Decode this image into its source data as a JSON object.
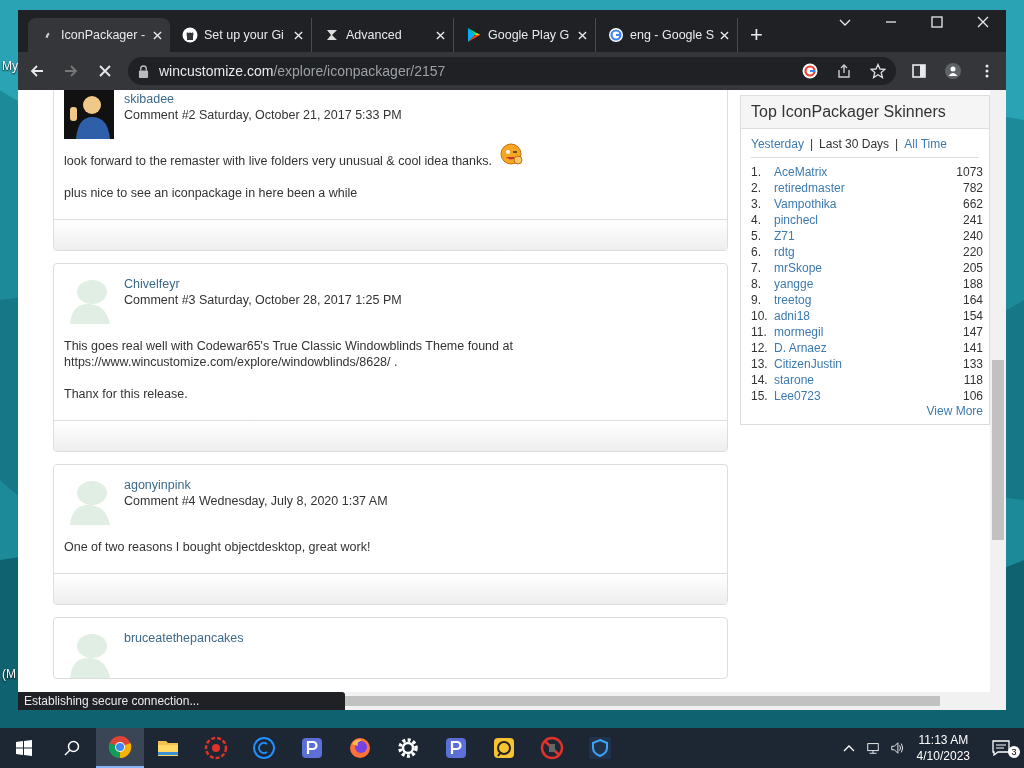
{
  "desktop": {
    "labels": [
      "My",
      "(M"
    ]
  },
  "browser": {
    "tabs": [
      {
        "title": "IconPackager -",
        "selected": true,
        "kind": "spinner"
      },
      {
        "title": "Set up your Gi",
        "selected": false,
        "kind": "github"
      },
      {
        "title": "Advanced",
        "selected": false,
        "kind": "s3"
      },
      {
        "title": "Google Play G",
        "selected": false,
        "kind": "play"
      },
      {
        "title": "eng - Google S",
        "selected": false,
        "kind": "google"
      }
    ],
    "new_tab": "+",
    "url_host": "wincustomize.com",
    "url_path": "/explore/iconpackager/2157",
    "status": "Establishing secure connection..."
  },
  "comments": [
    {
      "user": "skibadee",
      "meta": "Comment #2 Saturday, October 21, 2017 5:33 PM",
      "kind": "figure",
      "paragraphs": [
        {
          "text": "look forward to the remaster with live folders very unusual & cool idea thanks.",
          "emoji": true
        },
        {
          "text": "plus nice to see an iconpackage in here been a while",
          "emoji": false
        }
      ]
    },
    {
      "user": "Chivelfeyr",
      "meta": "Comment #3 Saturday, October 28, 2017 1:25 PM",
      "kind": "default",
      "paragraphs": [
        {
          "text": "This goes real well with Codewar65's True Classic Windowblinds Theme found at https://www.wincustomize.com/explore/windowblinds/8628/ .",
          "emoji": false
        },
        {
          "text": "Thanx for this release.",
          "emoji": false
        }
      ]
    },
    {
      "user": "agonyinpink",
      "meta": "Comment #4 Wednesday, July 8, 2020 1:37 AM",
      "kind": "default",
      "paragraphs": [
        {
          "text": "One of two reasons I bought objectdesktop, great work!",
          "emoji": false
        }
      ]
    },
    {
      "user": "bruceatethepancakes",
      "kind": "default"
    }
  ],
  "sidebar": {
    "title": "Top IconPackager Skinners",
    "periods": [
      {
        "label": "Yesterday",
        "selected": false
      },
      {
        "label": "Last 30 Days",
        "selected": true
      },
      {
        "label": "All Time",
        "selected": false
      }
    ],
    "separators": [
      "|",
      "|"
    ],
    "rows": [
      {
        "rank": "1.",
        "name": "AceMatrix",
        "count": "1073"
      },
      {
        "rank": "2.",
        "name": "retiredmaster",
        "count": "782"
      },
      {
        "rank": "3.",
        "name": "Vampothika",
        "count": "662"
      },
      {
        "rank": "4.",
        "name": "pinchecl",
        "count": "241"
      },
      {
        "rank": "5.",
        "name": "Z71",
        "count": "240"
      },
      {
        "rank": "6.",
        "name": "rdtg",
        "count": "220"
      },
      {
        "rank": "7.",
        "name": "mrSkope",
        "count": "205"
      },
      {
        "rank": "8.",
        "name": "yangge",
        "count": "188"
      },
      {
        "rank": "9.",
        "name": "treetog",
        "count": "164"
      },
      {
        "rank": "10.",
        "name": "adni18",
        "count": "154"
      },
      {
        "rank": "11.",
        "name": "mormegil",
        "count": "147"
      },
      {
        "rank": "12.",
        "name": "D. Arnaez",
        "count": "141"
      },
      {
        "rank": "13.",
        "name": "CitizenJustin",
        "count": "133"
      },
      {
        "rank": "14.",
        "name": "starone",
        "count": "118"
      },
      {
        "rank": "15.",
        "name": "Lee0723",
        "count": "106"
      }
    ],
    "more": "View More"
  },
  "taskbar": {
    "apps": [
      {
        "kind": "chrome",
        "active": true
      },
      {
        "kind": "folder",
        "active": false
      },
      {
        "kind": "redgear",
        "active": false
      },
      {
        "kind": "ccircle",
        "active": false
      },
      {
        "kind": "p",
        "active": false
      },
      {
        "kind": "firefox",
        "active": false
      },
      {
        "kind": "gear",
        "active": false
      },
      {
        "kind": "p",
        "active": false
      },
      {
        "kind": "yellow",
        "active": false
      },
      {
        "kind": "blocked",
        "active": false
      },
      {
        "kind": "shield",
        "active": false
      }
    ],
    "time": "11:13 AM",
    "date": "4/10/2023",
    "notifications": "3"
  }
}
